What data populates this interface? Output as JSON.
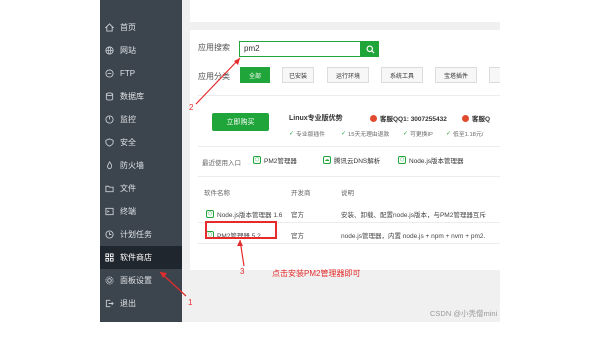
{
  "sidebar": {
    "items": [
      {
        "label": "首页",
        "icon": "home-icon"
      },
      {
        "label": "网站",
        "icon": "globe-icon"
      },
      {
        "label": "FTP",
        "icon": "ftp-icon"
      },
      {
        "label": "数据库",
        "icon": "database-icon"
      },
      {
        "label": "监控",
        "icon": "monitor-icon"
      },
      {
        "label": "安全",
        "icon": "shield-icon"
      },
      {
        "label": "防火墙",
        "icon": "firewall-icon"
      },
      {
        "label": "文件",
        "icon": "folder-icon"
      },
      {
        "label": "终端",
        "icon": "terminal-icon"
      },
      {
        "label": "计划任务",
        "icon": "clock-icon"
      },
      {
        "label": "软件商店",
        "icon": "grid-icon",
        "active": true
      },
      {
        "label": "面板设置",
        "icon": "gear-icon"
      },
      {
        "label": "退出",
        "icon": "logout-icon"
      }
    ]
  },
  "search": {
    "label": "应用搜索",
    "value": "pm2"
  },
  "categories": {
    "label": "应用分类",
    "tabs": [
      "全部",
      "已安装",
      "运行环境",
      "系统工具",
      "宝塔插件"
    ],
    "active": "全部"
  },
  "promo": {
    "buy_label": "立即购买",
    "title": "Linux专业版优势",
    "qq1": "客服QQ1: 3007255432",
    "qq2": "客服Q",
    "features": [
      "专业版插件",
      "15天无理由退款",
      "可更换IP",
      "低至1.18元/"
    ]
  },
  "recent": {
    "label": "最近使用入口",
    "items": [
      "PM2管理器",
      "腾讯云DNS解析",
      "Node.js版本管理器"
    ]
  },
  "table": {
    "headers": [
      "软件名称",
      "开发商",
      "说明"
    ],
    "rows": [
      {
        "name": "Node.js版本管理器 1.6",
        "vendor": "官方",
        "desc": "安装、卸载、配置node.js版本，与PM2管理器互斥"
      },
      {
        "name": "PM2管理器 5.2",
        "vendor": "官方",
        "desc": "node.js管理器，内置 node.js + npm + nvm + pm2."
      }
    ]
  },
  "annotations": {
    "n1": "1",
    "n2": "2",
    "n3": "3",
    "note": "点击安装PM2管理器即可"
  },
  "watermark": "CSDN @小秃僧mini",
  "colors": {
    "accent": "#20a53a",
    "sidebar": "#3c444d",
    "sidebar_active": "#20262d",
    "annotation": "#e52b2b"
  }
}
